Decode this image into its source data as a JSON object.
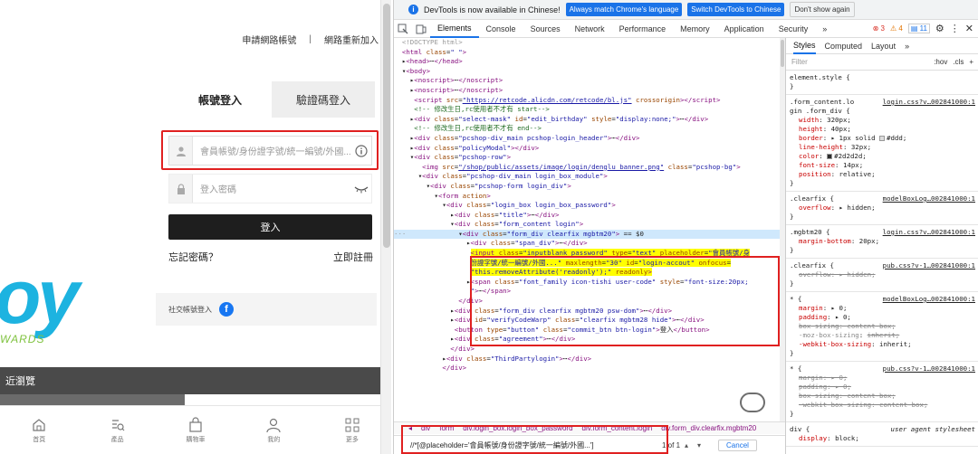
{
  "page": {
    "top_links": [
      "申請網路帳號",
      "|",
      "網路重新加入"
    ],
    "tabs": {
      "account_login": "帳號登入",
      "code_login": "驗證碼登入"
    },
    "account_placeholder": "會員帳號/身份證字號/統一編號/外國...",
    "password_placeholder": "登入密碼",
    "login_button": "登入",
    "forgot_password": "忘記密碼？",
    "register": "立即註冊",
    "social_label": "社交帳號登入",
    "facebook_glyph": "f",
    "brand_letters": "oy",
    "brand_tagline": "WARDS",
    "recent_viewed": "近瀏覽",
    "nav": [
      {
        "label": "首頁",
        "icon": "home-icon"
      },
      {
        "label": "產品",
        "icon": "product-search-icon"
      },
      {
        "label": "購物車",
        "icon": "cart-icon"
      },
      {
        "label": "我的",
        "icon": "user-icon"
      },
      {
        "label": "更多",
        "icon": "more-grid-icon"
      }
    ]
  },
  "devtools": {
    "notice": {
      "text": "DevTools is now available in Chinese!",
      "btn_match": "Always match Chrome's language",
      "btn_switch": "Switch DevTools to Chinese",
      "btn_dont": "Don't show again"
    },
    "tabs": [
      "Elements",
      "Console",
      "Sources",
      "Network",
      "Performance",
      "Memory",
      "Application",
      "Security"
    ],
    "more": "»",
    "errors": "3",
    "warnings": "4",
    "messages": "11",
    "crumbs": [
      "div",
      "form",
      "div.login_box.login_box_password",
      "div.form_content.login",
      "div.form_div.clearfix.mgbtm20"
    ],
    "crumb_prefix": "◂",
    "search_value": "//*[@placeholder='會員帳號/身份證字號/統一編號/外國...']",
    "search_count": "1 of 1",
    "cancel": "Cancel",
    "styles_tabs": [
      "Styles",
      "Computed",
      "Layout",
      "»"
    ],
    "filter_placeholder": "Filter",
    "filter_tools": [
      ":hov",
      ".cls",
      "+"
    ]
  }
}
